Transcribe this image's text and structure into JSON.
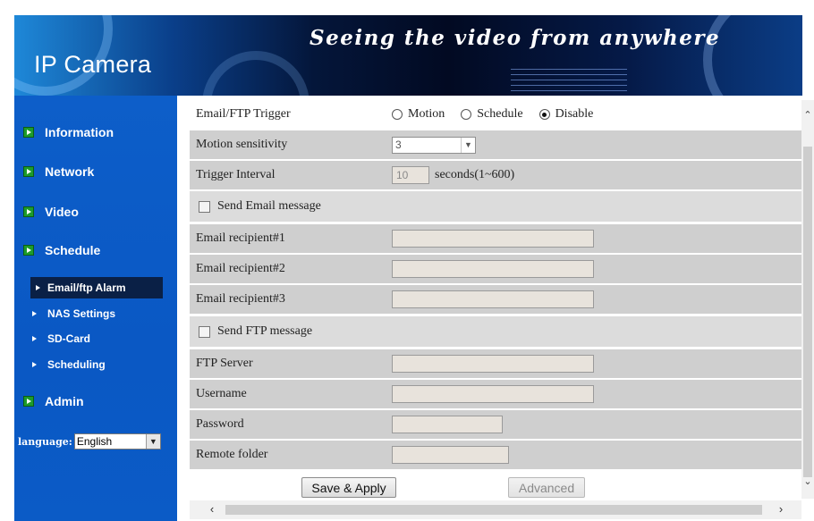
{
  "header": {
    "title": "IP Camera",
    "slogan": "Seeing the video from anywhere"
  },
  "sidebar": {
    "items": [
      {
        "label": "Information",
        "icon": "green-arrow-icon"
      },
      {
        "label": "Network",
        "icon": "green-arrow-icon"
      },
      {
        "label": "Video",
        "icon": "green-arrow-icon"
      },
      {
        "label": "Schedule",
        "icon": "green-arrow-icon"
      },
      {
        "label": "Admin",
        "icon": "green-arrow-icon"
      }
    ],
    "sub_items": [
      {
        "label": "Email/ftp Alarm",
        "active": true
      },
      {
        "label": "NAS Settings"
      },
      {
        "label": "SD-Card"
      },
      {
        "label": "Scheduling"
      }
    ],
    "language_label": "language:",
    "language_value": "English"
  },
  "form": {
    "trigger": {
      "label": "Email/FTP Trigger",
      "options": [
        "Motion",
        "Schedule",
        "Disable"
      ],
      "selected": "Disable"
    },
    "motion_sensitivity": {
      "label": "Motion sensitivity",
      "value": "3"
    },
    "trigger_interval": {
      "label": "Trigger Interval",
      "value": "10",
      "suffix": "seconds(1~600)"
    },
    "send_email": {
      "label": "Send Email message",
      "checked": false
    },
    "email_recipient_1": {
      "label": "Email recipient#1",
      "value": ""
    },
    "email_recipient_2": {
      "label": "Email recipient#2",
      "value": ""
    },
    "email_recipient_3": {
      "label": "Email recipient#3",
      "value": ""
    },
    "send_ftp": {
      "label": "Send FTP message",
      "checked": false
    },
    "ftp_server": {
      "label": "FTP Server",
      "value": ""
    },
    "username": {
      "label": "Username",
      "value": ""
    },
    "password": {
      "label": "Password",
      "value": ""
    },
    "remote_folder": {
      "label": "Remote folder",
      "value": ""
    }
  },
  "buttons": {
    "save": "Save & Apply",
    "advanced": "Advanced"
  },
  "colors": {
    "sidebar_blue": "#0b5bc6",
    "row_gray": "#cfcfcf",
    "active_item": "#0a2046",
    "icon_green": "#1d9c2a"
  }
}
